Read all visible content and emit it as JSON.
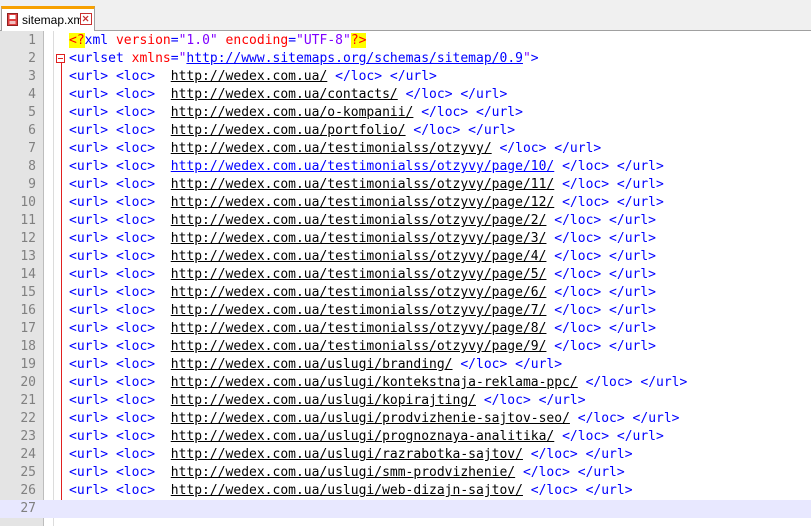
{
  "tab": {
    "filename": "sitemap.xml",
    "icon": "save-file-icon",
    "close_icon": "close-icon"
  },
  "colors": {
    "tag": "#0000ff",
    "attribute": "#ff0000",
    "value": "#8000ff",
    "pi_highlight": "#ffff00",
    "gutter": "#e4e4e4",
    "current_line": "#e8e8ff"
  },
  "line_numbers": [
    "1",
    "2",
    "3",
    "4",
    "5",
    "6",
    "7",
    "8",
    "9",
    "10",
    "11",
    "12",
    "13",
    "14",
    "15",
    "16",
    "17",
    "18",
    "19",
    "20",
    "21",
    "22",
    "23",
    "24",
    "25",
    "26",
    "27"
  ],
  "decl": {
    "open": "<?",
    "name": "xml ",
    "a1": "version",
    "eq1": "=",
    "v1": "\"1.0\"",
    "a2": " encoding",
    "eq2": "=",
    "v2": "\"UTF-8\"",
    "close": "?>"
  },
  "urlset": {
    "open": "<urlset ",
    "attr": "xmlns",
    "eq": "=",
    "q1": "\"",
    "href": "http://www.sitemaps.org/schemas/sitemap/0.9",
    "q2": "\"",
    "close": ">"
  },
  "entry_prefix": "<url> <loc>",
  "entry_suffix": "</loc> </url>",
  "urls": [
    "http://wedex.com.ua/",
    "http://wedex.com.ua/contacts/",
    "http://wedex.com.ua/o-kompanii/",
    "http://wedex.com.ua/portfolio/",
    "http://wedex.com.ua/testimonialss/otzyvy/",
    "http://wedex.com.ua/testimonialss/otzyvy/page/10/",
    "http://wedex.com.ua/testimonialss/otzyvy/page/11/",
    "http://wedex.com.ua/testimonialss/otzyvy/page/12/",
    "http://wedex.com.ua/testimonialss/otzyvy/page/2/",
    "http://wedex.com.ua/testimonialss/otzyvy/page/3/",
    "http://wedex.com.ua/testimonialss/otzyvy/page/4/",
    "http://wedex.com.ua/testimonialss/otzyvy/page/5/",
    "http://wedex.com.ua/testimonialss/otzyvy/page/6/",
    "http://wedex.com.ua/testimonialss/otzyvy/page/7/",
    "http://wedex.com.ua/testimonialss/otzyvy/page/8/",
    "http://wedex.com.ua/testimonialss/otzyvy/page/9/",
    "http://wedex.com.ua/uslugi/branding/",
    "http://wedex.com.ua/uslugi/kontekstnaja-reklama-ppc/",
    "http://wedex.com.ua/uslugi/kopirajting/",
    "http://wedex.com.ua/uslugi/prodvizhenie-sajtov-seo/",
    "http://wedex.com.ua/uslugi/prognoznaya-analitika/",
    "http://wedex.com.ua/uslugi/razrabotka-sajtov/",
    "http://wedex.com.ua/uslugi/smm-prodvizhenie/",
    "http://wedex.com.ua/uslugi/web-dizajn-sajtov/"
  ]
}
